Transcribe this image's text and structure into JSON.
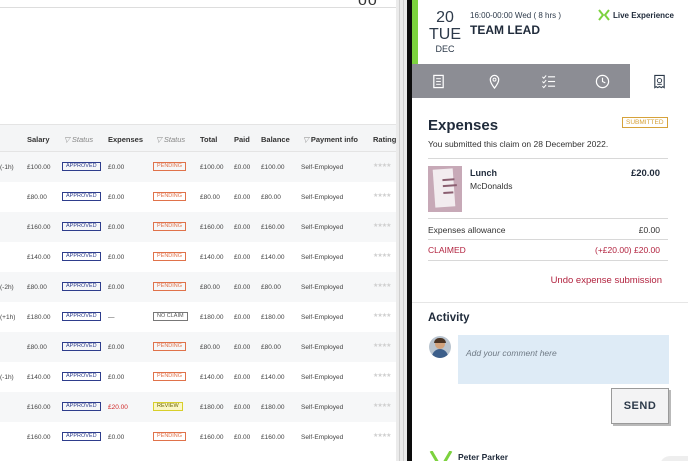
{
  "table": {
    "top_glyph": "oo",
    "headers": {
      "salary": "Salary",
      "status1": "Status",
      "expenses": "Expenses",
      "status2": "Status",
      "total": "Total",
      "paid": "Paid",
      "balance": "Balance",
      "payment": "Payment info",
      "rating": "Rating"
    },
    "rows": [
      {
        "note": "(-1h)",
        "salary": "£100.00",
        "status": "APPROVED",
        "expenses": "£0.00",
        "expStatus": "PENDING",
        "total": "£100.00",
        "paid": "£0.00",
        "balance": "£100.00",
        "payment": "Self-Employed"
      },
      {
        "note": "",
        "salary": "£80.00",
        "status": "APPROVED",
        "expenses": "£0.00",
        "expStatus": "PENDING",
        "total": "£80.00",
        "paid": "£0.00",
        "balance": "£80.00",
        "payment": "Self-Employed"
      },
      {
        "note": "",
        "salary": "£160.00",
        "status": "APPROVED",
        "expenses": "£0.00",
        "expStatus": "PENDING",
        "total": "£160.00",
        "paid": "£0.00",
        "balance": "£160.00",
        "payment": "Self-Employed"
      },
      {
        "note": "",
        "salary": "£140.00",
        "status": "APPROVED",
        "expenses": "£0.00",
        "expStatus": "PENDING",
        "total": "£140.00",
        "paid": "£0.00",
        "balance": "£140.00",
        "payment": "Self-Employed"
      },
      {
        "note": "(-2h)",
        "salary": "£80.00",
        "status": "APPROVED",
        "expenses": "£0.00",
        "expStatus": "PENDING",
        "total": "£80.00",
        "paid": "£0.00",
        "balance": "£80.00",
        "payment": "Self-Employed"
      },
      {
        "note": "(+1h)",
        "salary": "£180.00",
        "status": "APPROVED",
        "expenses": "—",
        "expStatus": "NO CLAIM",
        "total": "£180.00",
        "paid": "£0.00",
        "balance": "£180.00",
        "payment": "Self-Employed"
      },
      {
        "note": "",
        "salary": "£80.00",
        "status": "APPROVED",
        "expenses": "£0.00",
        "expStatus": "PENDING",
        "total": "£80.00",
        "paid": "£0.00",
        "balance": "£80.00",
        "payment": "Self-Employed"
      },
      {
        "note": "(-1h)",
        "salary": "£140.00",
        "status": "APPROVED",
        "expenses": "£0.00",
        "expStatus": "PENDING",
        "total": "£140.00",
        "paid": "£0.00",
        "balance": "£140.00",
        "payment": "Self-Employed"
      },
      {
        "note": "",
        "salary": "£160.00",
        "status": "APPROVED",
        "expenses": "£20.00",
        "expStatus": "REVIEW",
        "total": "£180.00",
        "paid": "£0.00",
        "balance": "£180.00",
        "payment": "Self-Employed"
      },
      {
        "note": "",
        "salary": "£160.00",
        "status": "APPROVED",
        "expenses": "£0.00",
        "expStatus": "PENDING",
        "total": "£160.00",
        "paid": "£0.00",
        "balance": "£160.00",
        "payment": "Self-Employed"
      }
    ]
  },
  "shift": {
    "day": "20",
    "weekday": "TUE",
    "month": "DEC",
    "time": "16:00-00:00 Wed ( 8 hrs )",
    "role": "TEAM LEAD",
    "live_label": "Live Experience"
  },
  "tabs": [
    {
      "icon": "document-icon",
      "active": false
    },
    {
      "icon": "location-pin-icon",
      "active": false
    },
    {
      "icon": "checklist-icon",
      "active": false
    },
    {
      "icon": "clock-icon",
      "active": false
    },
    {
      "icon": "receipt-icon",
      "active": true
    }
  ],
  "expenses": {
    "title": "Expenses",
    "badge": "SUBMITTED",
    "submitted_text": "You submitted this claim on 28 December 2022.",
    "item_name": "Lunch",
    "item_vendor": "McDonalds",
    "item_amount": "£20.00",
    "allowance_label": "Expenses allowance",
    "allowance_value": "£0.00",
    "claimed_label": "CLAIMED",
    "claimed_value": "(+£20.00) £20.00",
    "undo_label": "Undo expense submission"
  },
  "activity": {
    "title": "Activity",
    "comment_placeholder": "Add your comment here",
    "send_label": "SEND",
    "user_name": "Peter Parker"
  },
  "colors": {
    "accent_green": "#7cd23e",
    "claimed_red": "#b2233f",
    "approved_blue": "#2e3d8c",
    "pending_orange": "#e0724a",
    "submitted_gold": "#d6a23a"
  }
}
